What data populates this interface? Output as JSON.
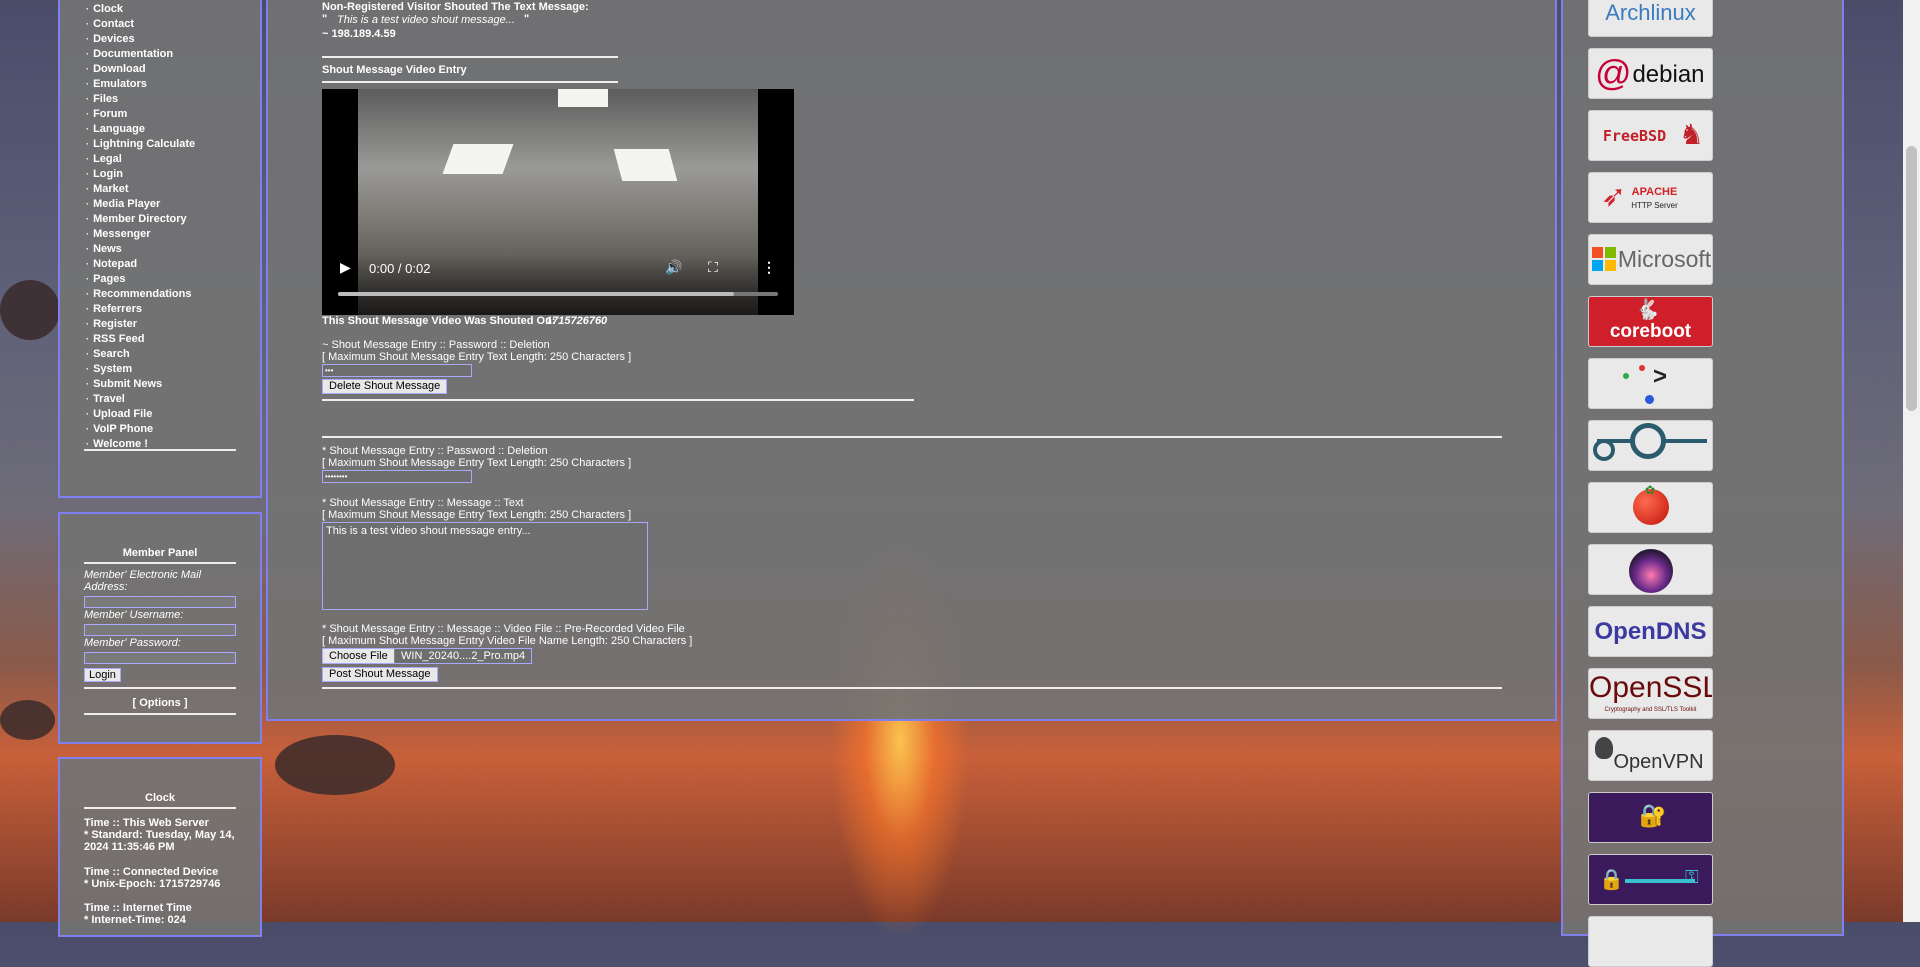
{
  "menu": {
    "items": [
      "Clock",
      "Contact",
      "Devices",
      "Documentation",
      "Download",
      "Emulators",
      "Files",
      "Forum",
      "Language",
      "Lightning Calculate",
      "Legal",
      "Login",
      "Market",
      "Media Player",
      "Member Directory",
      "Messenger",
      "News",
      "Notepad",
      "Pages",
      "Recommendations",
      "Referrers",
      "Register",
      "RSS Feed",
      "Search",
      "System",
      "Submit News",
      "Travel",
      "Upload File",
      "VoIP Phone",
      "Welcome !"
    ]
  },
  "member_panel": {
    "title": "Member Panel",
    "email_label": "Member' Electronic Mail Address:",
    "username_label": "Member' Username:",
    "password_label": "Member' Password:",
    "login_button": "Login",
    "options_link": "[ Options ]"
  },
  "clock_panel": {
    "title": "Clock",
    "server_heading": "Time :: This Web Server",
    "server_standard": "* Standard: Tuesday, May 14, 2024 11:35:46 PM",
    "device_heading": "Time :: Connected Device",
    "device_epoch": "* Unix-Epoch: 1715729746",
    "internet_heading": "Time :: Internet Time",
    "internet_time": "* Internet-Time: 024"
  },
  "shout": {
    "visitor_line": "Non-Registered Visitor Shouted The Text Message:",
    "open_quote": "\"",
    "message": "This is a test video shout message...",
    "close_quote": "\"",
    "ip": "~ 198.189.4.59",
    "video_entry_title": "Shout Message Video Entry",
    "video_time": "0:00 / 0:02",
    "shouted_on_label": "This Shout Message Video Was Shouted On:",
    "shouted_on_value": "1715726760",
    "delete_heading": "~ Shout Message Entry :: Password :: Deletion",
    "delete_max": "[ Maximum Shout Message Entry Text Length: 250 Characters ]",
    "delete_pw_value": "•••",
    "delete_button": "Delete Shout Message"
  },
  "form": {
    "pw_heading": "* Shout Message Entry :: Password :: Deletion",
    "pw_max": "[ Maximum Shout Message Entry Text Length: 250 Characters ]",
    "pw_value": "••••••••",
    "text_heading": "* Shout Message Entry :: Message :: Text",
    "text_max": "[ Maximum Shout Message Entry Text Length: 250 Characters ]",
    "text_value": "This is a test video shout message entry...",
    "video_heading": "* Shout Message Entry :: Message :: Video File :: Pre-Recorded Video File",
    "video_max": "[ Maximum Shout Message Entry Video File Name Length: 250 Characters ]",
    "choose_file": "Choose File",
    "file_name": "WIN_20240....2_Pro.mp4",
    "post_button": "Post Shout Message"
  },
  "badges": {
    "arch": "Archlinux",
    "debian": "debian",
    "freebsd": "FreeBSD",
    "apache_1": "APACHE",
    "apache_2": "HTTP Server",
    "microsoft": "Microsoft",
    "coreboot": "coreboot",
    "opendns": "OpenDNS",
    "openssl": "OpenSSL",
    "openssl_sub": "Cryptography and SSL/TLS Toolkit",
    "openvpn": "OpenVPN"
  },
  "colors": {
    "panel_border": "#7f7ff0",
    "panel_bg": "#737373",
    "opendns_blue": "#3a3aa0",
    "freebsd_red": "#c0202a"
  }
}
